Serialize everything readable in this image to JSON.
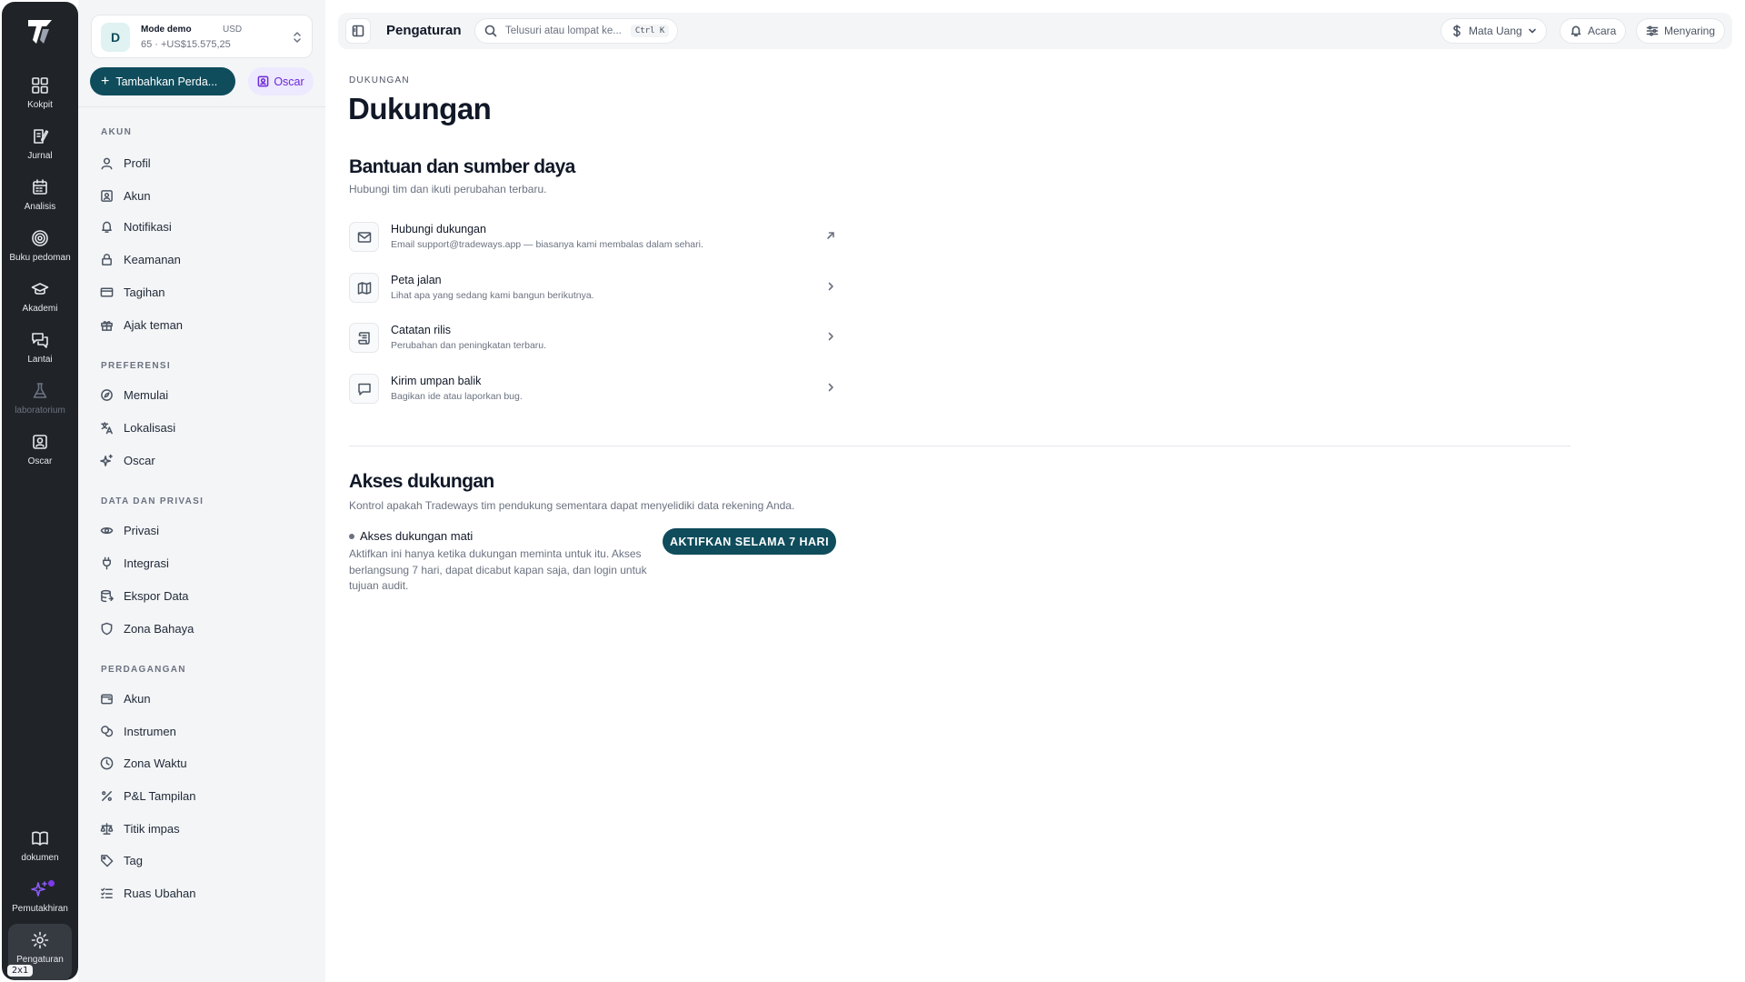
{
  "rail": {
    "items": [
      {
        "label": "Kokpit",
        "icon": "dashboard-icon"
      },
      {
        "label": "Jurnal",
        "icon": "journal-icon"
      },
      {
        "label": "Analisis",
        "icon": "calendar-icon"
      },
      {
        "label": "Buku pedoman",
        "icon": "target-icon"
      },
      {
        "label": "Akademi",
        "icon": "graduation-cap-icon"
      },
      {
        "label": "Lantai",
        "icon": "chat-icon"
      },
      {
        "label": "laboratorium",
        "icon": "flask-icon"
      },
      {
        "label": "Oscar",
        "icon": "user-square-icon"
      }
    ],
    "bottom": [
      {
        "label": "dokumen",
        "icon": "book-icon"
      },
      {
        "label": "Pemutakhiran",
        "icon": "sparkle-icon"
      },
      {
        "label": "Pengaturan",
        "icon": "gear-icon"
      }
    ],
    "badge": "2x1"
  },
  "sidebar": {
    "account": {
      "avatar": "D",
      "name": "Mode demo",
      "currency": "USD",
      "balance": "65 · +US$15.575,25"
    },
    "add_button": "Tambahkan Perda...",
    "oscar_button": "Oscar",
    "sections": [
      {
        "title": "AKUN",
        "items": [
          "Profil",
          "Akun",
          "Notifikasi",
          "Keamanan",
          "Tagihan",
          "Ajak teman"
        ]
      },
      {
        "title": "PREFERENSI",
        "items": [
          "Memulai",
          "Lokalisasi",
          "Oscar"
        ]
      },
      {
        "title": "DATA DAN PRIVASI",
        "items": [
          "Privasi",
          "Integrasi",
          "Ekspor Data",
          "Zona Bahaya"
        ]
      },
      {
        "title": "PERDAGANGAN",
        "items": [
          "Akun",
          "Instrumen",
          "Zona Waktu",
          "P&L Tampilan",
          "Titik impas",
          "Tag",
          "Ruas Ubahan"
        ]
      }
    ]
  },
  "topbar": {
    "title": "Pengaturan",
    "search_placeholder": "Telusuri atau lompat ke...",
    "search_shortcut": "Ctrl K",
    "currency_button": "Mata Uang",
    "events_button": "Acara",
    "filter_button": "Menyaring"
  },
  "page": {
    "breadcrumb": "DUKUNGAN",
    "title": "Dukungan",
    "resources": {
      "title": "Bantuan dan sumber daya",
      "subtitle": "Hubungi tim dan ikuti perubahan terbaru.",
      "rows": [
        {
          "title": "Hubungi dukungan",
          "desc": "Email support@tradeways.app — biasanya kami membalas dalam sehari.",
          "icon": "mail-icon",
          "arrow": "external-link-icon"
        },
        {
          "title": "Peta jalan",
          "desc": "Lihat apa yang sedang kami bangun berikutnya.",
          "icon": "map-icon",
          "arrow": "chevron-right-icon"
        },
        {
          "title": "Catatan rilis",
          "desc": "Perubahan dan peningkatan terbaru.",
          "icon": "scroll-icon",
          "arrow": "chevron-right-icon"
        },
        {
          "title": "Kirim umpan balik",
          "desc": "Bagikan ide atau laporkan bug.",
          "icon": "message-icon",
          "arrow": "chevron-right-icon"
        }
      ]
    },
    "access": {
      "title": "Akses dukungan",
      "subtitle": "Kontrol apakah Tradeways tim pendukung sementara dapat menyelidiki data rekening Anda.",
      "status": "Akses dukungan mati",
      "desc": "Aktifkan ini hanya ketika dukungan meminta untuk itu. Akses berlangsung 7 hari, dapat dicabut kapan saja, dan login untuk tujuan audit.",
      "button": "AKTIFKAN SELAMA 7 HARI"
    }
  },
  "colors": {
    "rail_bg": "#202429",
    "sidebar_bg": "#f4f5f7",
    "primary": "#0f4c5c",
    "oscar": "#6d28d9"
  }
}
